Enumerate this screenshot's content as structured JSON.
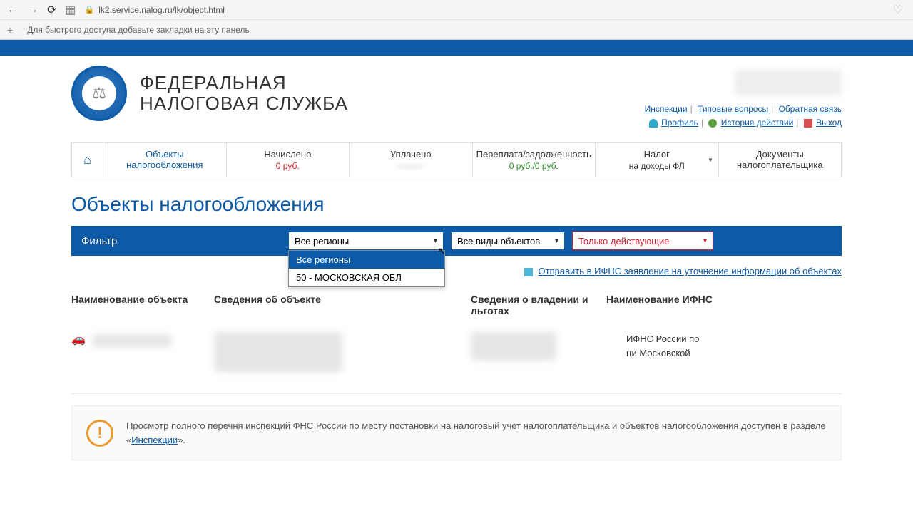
{
  "browser": {
    "url": "lk2.service.nalog.ru/lk/object.html",
    "bookmarks_hint": "Для быстрого доступа добавьте закладки на эту панель"
  },
  "brand": {
    "line1": "ФЕДЕРАЛЬНАЯ",
    "line2": "НАЛОГОВАЯ СЛУЖБА"
  },
  "user_links": {
    "inspections": "Инспекции",
    "faq": "Типовые вопросы",
    "feedback": "Обратная связь",
    "profile": "Профиль",
    "history": "История действий",
    "logout": "Выход"
  },
  "tabs": {
    "objects": "Объекты налогообложения",
    "accrued": "Начислено",
    "accrued_val": "0 руб.",
    "paid": "Уплачено",
    "overunder": "Переплата/задолженность",
    "overunder_val": "0 руб./0 руб.",
    "ndfl": "Налог",
    "ndfl_sub": "на доходы ФЛ",
    "docs": "Документы налогоплательщика"
  },
  "page_title": "Объекты налогообложения",
  "filter": {
    "label": "Фильтр",
    "region_selected": "Все регионы",
    "region_options": [
      "Все регионы",
      "50 - МОСКОВСКАЯ ОБЛ"
    ],
    "type_selected": "Все виды объектов",
    "status_selected": "Только действующие"
  },
  "action_link": "Отправить в ИФНС заявление на уточнение информации об объектах",
  "columns": {
    "c1": "Наименование объекта",
    "c2": "Сведения об объекте",
    "c3": "Сведения о владении и льготах",
    "c4": "Наименование ИФНС"
  },
  "row": {
    "ifns_line1": "ИФНС России по",
    "ifns_line2": "ци Московской"
  },
  "notice": {
    "text_pre": "Просмотр полного перечня инспекций ФНС России по месту постановки на налоговый учет налогоплательщика и объектов налогообложения доступен в разделе «",
    "link": "Инспекции",
    "text_post": "»."
  }
}
